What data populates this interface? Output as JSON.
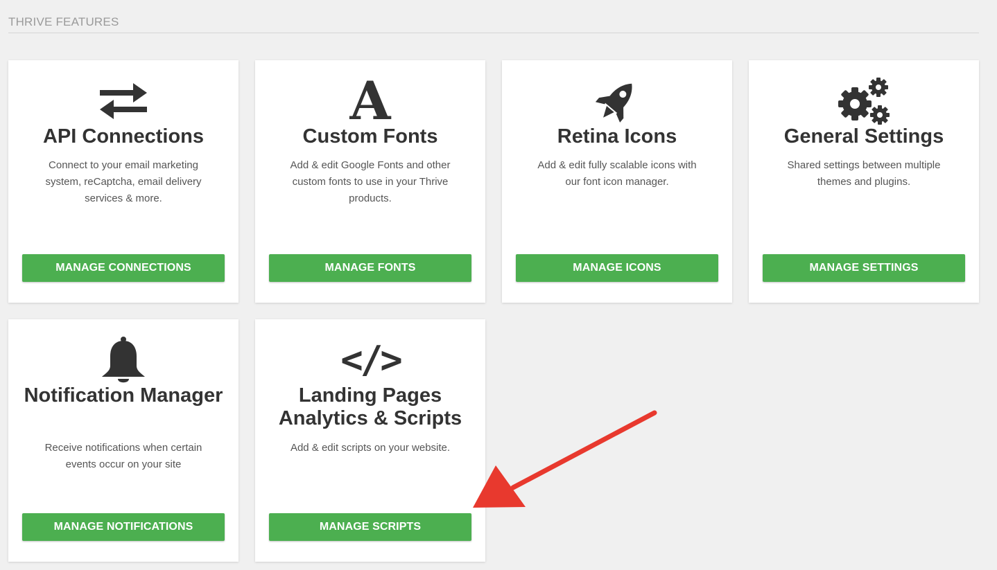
{
  "section": {
    "title": "THRIVE FEATURES"
  },
  "colors": {
    "button": "#4caf50",
    "arrow": "#e8392e",
    "icon": "#333333"
  },
  "cards": [
    {
      "icon": "exchange-arrows-icon",
      "title": "API Connections",
      "description": "Connect to your email marketing system, reCaptcha, email delivery services & more.",
      "button": "MANAGE CONNECTIONS"
    },
    {
      "icon": "font-icon",
      "icon_glyph": "A",
      "title": "Custom Fonts",
      "description": "Add & edit Google Fonts and other custom fonts to use in your Thrive products.",
      "button": "MANAGE FONTS"
    },
    {
      "icon": "rocket-icon",
      "title": "Retina Icons",
      "description": "Add & edit fully scalable icons with our font icon manager.",
      "button": "MANAGE ICONS"
    },
    {
      "icon": "gears-icon",
      "title": "General Settings",
      "description": "Shared settings between multiple themes and plugins.",
      "button": "MANAGE SETTINGS"
    },
    {
      "icon": "bell-icon",
      "title": "Notification Manager",
      "description": "Receive notifications when certain events occur on your site",
      "button": "MANAGE NOTIFICATIONS"
    },
    {
      "icon": "code-icon",
      "icon_glyph": "</>",
      "title": "Landing Pages Analytics & Scripts",
      "description": "Add & edit scripts on your website.",
      "button": "MANAGE SCRIPTS"
    }
  ],
  "annotation": {
    "type": "arrow",
    "points_to": "MANAGE SCRIPTS"
  }
}
